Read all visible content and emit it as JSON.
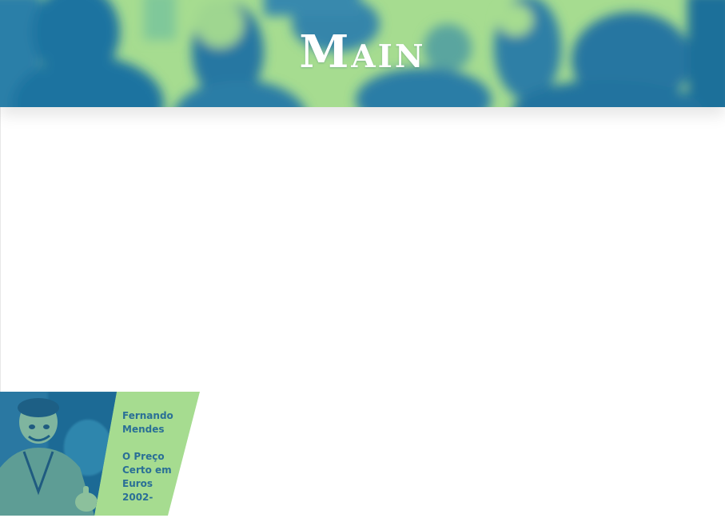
{
  "header": {
    "title": "Main"
  },
  "card": {
    "name": "Fernando Mendes",
    "description": "O Preço Certo em Euros 2002-"
  },
  "colors": {
    "accent_green": "#a6dc90",
    "accent_blue": "#1f6f9a",
    "text_blue": "#2a6f96"
  }
}
